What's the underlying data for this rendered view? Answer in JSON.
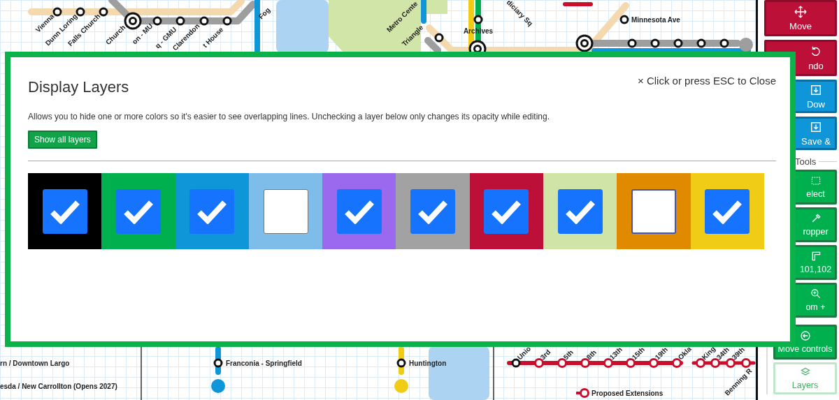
{
  "map": {
    "station_labels": [
      "Vienna",
      "Dunn Loring",
      "Falls Church",
      "Church",
      "on - MU",
      "q - GMU",
      "Clarendon",
      "t House",
      "Fog",
      "Metro Cente",
      "Triangle",
      "Archives",
      "diciary Sq",
      "Minnesota Ave",
      "rn / Downtown Largo",
      "esda / New Carrollton (Opens 2027)",
      "Franconia - Springfield",
      "Huntington",
      "Unio",
      "3rd",
      "5th",
      "8th",
      "13th",
      "15th",
      "19th",
      "Okla",
      "King",
      "34th",
      "39th",
      "Benning R"
    ],
    "legend": "Proposed Extensions"
  },
  "sidebar": {
    "buttons": [
      {
        "label": "Move",
        "kind": "danger"
      },
      {
        "label": "ndo",
        "kind": "danger"
      },
      {
        "label": "Dow",
        "kind": "primary"
      },
      {
        "label": "Save &",
        "kind": "primary"
      }
    ],
    "section_title": "Tools",
    "tools": [
      {
        "label": "elect",
        "selected": false
      },
      {
        "label": "ropper",
        "selected": false
      },
      {
        "label": "101,102",
        "selected": false
      },
      {
        "label": "om +",
        "selected": false
      },
      {
        "label": "Move controls",
        "selected": false
      },
      {
        "label": "Layers",
        "selected": true
      }
    ]
  },
  "modal": {
    "title": "Display Layers",
    "close_hint": "× Click or press ESC to Close",
    "description": "Allows you to hide one or more colors so it's easier to see overlapping lines. Unchecking a layer below only changes its opacity while editing.",
    "show_all_button": "Show all layers",
    "layers": [
      {
        "color": "#000000",
        "checked": true,
        "focused": false
      },
      {
        "color": "#00b04f",
        "checked": true,
        "focused": false
      },
      {
        "color": "#0e96d8",
        "checked": true,
        "focused": false
      },
      {
        "color": "#7ebde9",
        "checked": false,
        "focused": false
      },
      {
        "color": "#9b69ee",
        "checked": true,
        "focused": false
      },
      {
        "color": "#a2a2a2",
        "checked": true,
        "focused": false
      },
      {
        "color": "#bc1038",
        "checked": true,
        "focused": false
      },
      {
        "color": "#d1e4a8",
        "checked": true,
        "focused": false
      },
      {
        "color": "#e08a00",
        "checked": false,
        "focused": true
      },
      {
        "color": "#f0cc16",
        "checked": true,
        "focused": false
      }
    ]
  }
}
